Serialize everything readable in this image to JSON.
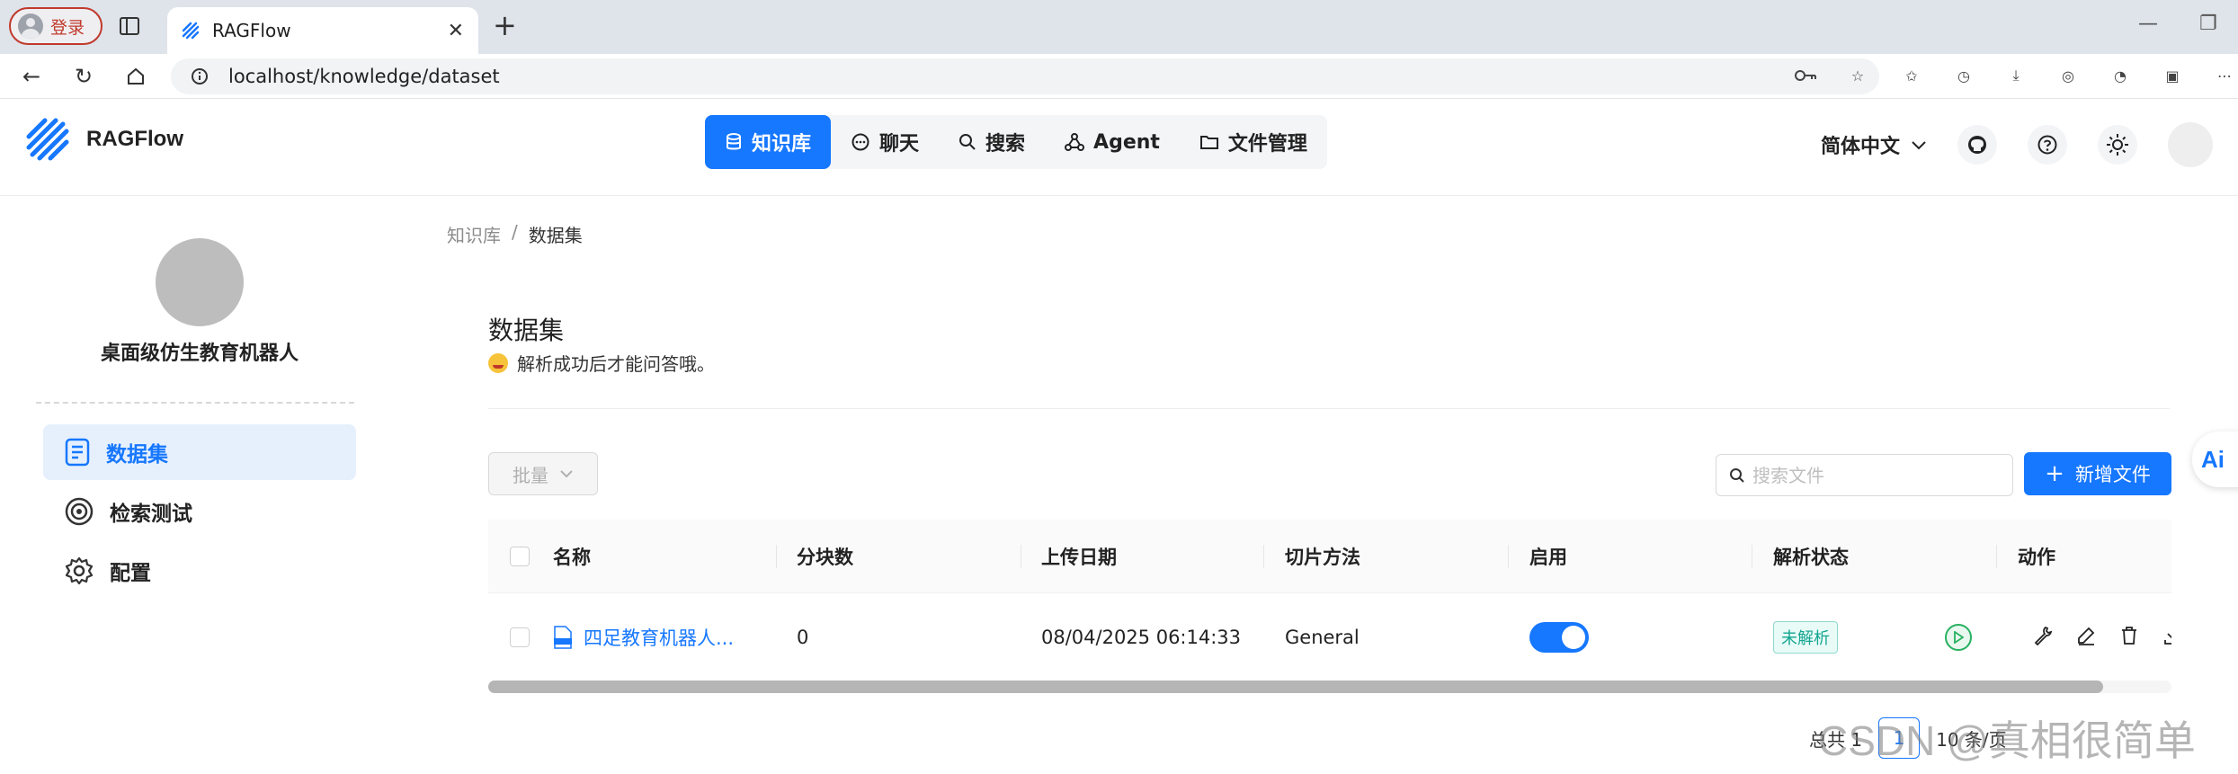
{
  "browser": {
    "profile_label": "登录",
    "tab_title": "RAGFlow",
    "url": "localhost/knowledge/dataset"
  },
  "header": {
    "logo_text": "RAGFlow",
    "nav": [
      {
        "label": "知识库",
        "icon": "database-icon",
        "active": true
      },
      {
        "label": "聊天",
        "icon": "chat-icon",
        "active": false
      },
      {
        "label": "搜索",
        "icon": "search-icon",
        "active": false
      },
      {
        "label": "Agent",
        "icon": "agent-icon",
        "active": false
      },
      {
        "label": "文件管理",
        "icon": "folder-icon",
        "active": false
      }
    ],
    "language": "简体中文"
  },
  "sidebar": {
    "kb_name": "桌面级仿生教育机器人",
    "items": [
      {
        "label": "数据集",
        "icon": "document-icon",
        "active": true
      },
      {
        "label": "检索测试",
        "icon": "target-icon",
        "active": false
      },
      {
        "label": "配置",
        "icon": "gear-icon",
        "active": false
      }
    ]
  },
  "breadcrumb": {
    "root": "知识库",
    "separator": "/",
    "current": "数据集"
  },
  "main": {
    "title": "数据集",
    "description": "解析成功后才能问答哦。",
    "batch_label": "批量",
    "search_placeholder": "搜索文件",
    "add_label": "新增文件"
  },
  "table": {
    "columns": [
      "名称",
      "分块数",
      "上传日期",
      "切片方法",
      "启用",
      "解析状态",
      "动作"
    ],
    "rows": [
      {
        "name": "四足教育机器人...",
        "chunks": "0",
        "upload_date": "08/04/2025 06:14:33",
        "method": "General",
        "enabled": true,
        "status": "未解析"
      }
    ]
  },
  "pagination": {
    "total_label": "总共 1",
    "page": "1",
    "page_size_label": "10 条/页"
  },
  "side_float_label": "Ai",
  "watermark": "CSDN @真相很简单",
  "colors": {
    "primary": "#1677ff",
    "status_tag": "#13a590",
    "play": "#27b160"
  }
}
